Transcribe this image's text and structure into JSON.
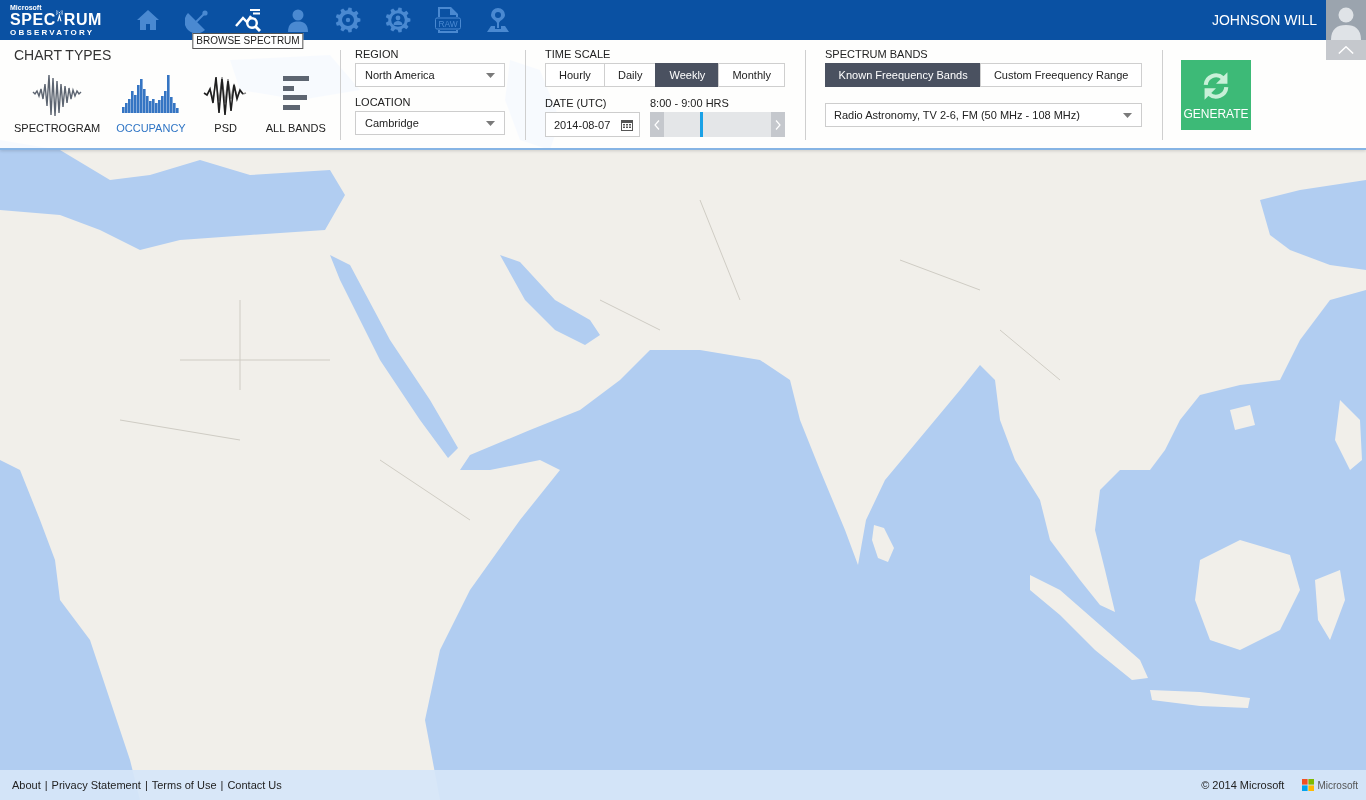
{
  "header": {
    "logo": {
      "brand": "Microsoft",
      "title_start": "SPEC",
      "title_end": "RUM",
      "subtitle": "OBSERVATORY"
    },
    "nav": [
      {
        "kind": "home",
        "selected": false
      },
      {
        "kind": "dish",
        "selected": false
      },
      {
        "kind": "browse",
        "selected": true
      },
      {
        "kind": "person",
        "selected": false
      },
      {
        "kind": "gear",
        "selected": false
      },
      {
        "kind": "gear-person",
        "selected": false
      },
      {
        "kind": "raw",
        "selected": false,
        "icon_text": "RAW"
      },
      {
        "kind": "pin",
        "selected": false
      }
    ],
    "tooltip": "BROWSE SPECTRUM",
    "user": {
      "name": "JOHNSON WILL"
    }
  },
  "panel": {
    "chart_types": {
      "title": "CHART TYPES",
      "items": [
        {
          "kind": "spectrogram",
          "label": "SPECTROGRAM",
          "selected": false
        },
        {
          "kind": "occupancy",
          "label": "OCCUPANCY",
          "selected": true
        },
        {
          "kind": "psd",
          "label": "PSD",
          "selected": false
        },
        {
          "kind": "all_bands",
          "label": "ALL BANDS",
          "selected": false
        }
      ]
    },
    "region": {
      "label": "REGION",
      "value": "North America"
    },
    "location": {
      "label": "LOCATION",
      "value": "Cambridge"
    },
    "time_scale": {
      "label": "TIME SCALE",
      "options": [
        {
          "label": "Hourly",
          "selected": false
        },
        {
          "label": "Daily",
          "selected": false
        },
        {
          "label": "Weekly",
          "selected": true
        },
        {
          "label": "Monthly",
          "selected": false
        }
      ]
    },
    "date": {
      "label": "DATE (UTC)",
      "value": "2014-08-07"
    },
    "time_range": {
      "label": "8:00 - 9:00 HRS",
      "level": 0.35
    },
    "spectrum_bands": {
      "label": "SPECTRUM BANDS",
      "options": [
        {
          "label": "Known Freequency Bands",
          "selected": true
        },
        {
          "label": "Custom Freequency Range",
          "selected": false
        }
      ],
      "value": "Radio Astronomy, TV 2-6, FM (50 MHz - 108 MHz)"
    },
    "generate_button": {
      "label": "GENERATE"
    }
  },
  "footer": {
    "links": [
      "About",
      "Privacy Statement",
      "Terms of Use",
      "Contact Us"
    ],
    "separator": "|",
    "copyright": "© 2014 Microsoft",
    "brand": "Microsoft"
  }
}
